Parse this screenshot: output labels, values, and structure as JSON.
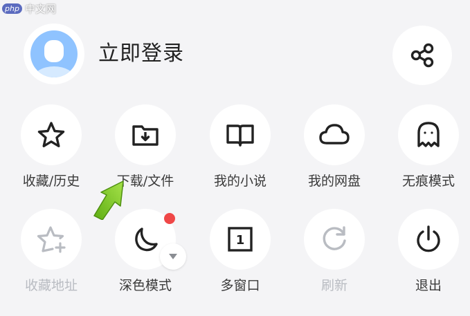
{
  "watermark": {
    "badge": "php",
    "text": "中文网"
  },
  "header": {
    "login_label": "立即登录",
    "share_icon": "share-icon",
    "avatar_icon": "default-avatar-icon"
  },
  "menu": {
    "row1": [
      {
        "label": "收藏/历史",
        "icon": "star-icon",
        "enabled": true
      },
      {
        "label": "下载/文件",
        "icon": "download-folder-icon",
        "enabled": true
      },
      {
        "label": "我的小说",
        "icon": "book-icon",
        "enabled": true
      },
      {
        "label": "我的网盘",
        "icon": "cloud-icon",
        "enabled": true
      },
      {
        "label": "无痕模式",
        "icon": "ghost-icon",
        "enabled": true
      }
    ],
    "row2": [
      {
        "label": "收藏地址",
        "icon": "star-add-icon",
        "enabled": false
      },
      {
        "label": "深色模式",
        "icon": "moon-icon",
        "enabled": true,
        "has_notification_dot": true,
        "has_dropdown": true
      },
      {
        "label": "多窗口",
        "icon": "window-count-icon",
        "enabled": true,
        "window_count": "1"
      },
      {
        "label": "刷新",
        "icon": "refresh-icon",
        "enabled": false
      },
      {
        "label": "退出",
        "icon": "power-icon",
        "enabled": true
      }
    ]
  },
  "colors": {
    "background": "#f4f4f6",
    "tile": "#ffffff",
    "text": "#3a3a3a",
    "disabled": "#b9bcc2",
    "notification_dot": "#ef4747",
    "avatar_blue": "#8fc3ff",
    "annotation_arrow": "#7ecb1f"
  }
}
